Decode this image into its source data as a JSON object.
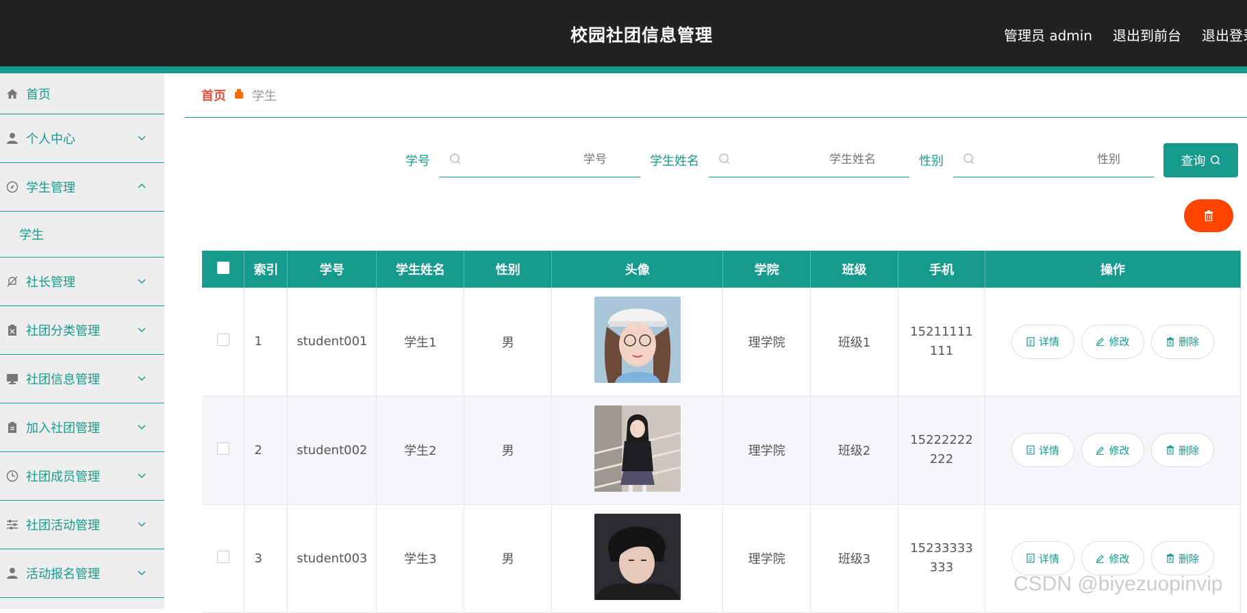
{
  "header": {
    "title": "校园社团信息管理",
    "admin_label": "管理员 admin",
    "to_front_label": "退出到前台",
    "logout_label": "退出登录"
  },
  "sidebar": {
    "items": [
      {
        "label": "首页",
        "icon": "home-icon"
      },
      {
        "label": "个人中心",
        "icon": "user-icon"
      },
      {
        "label": "学生管理",
        "icon": "compass-icon"
      },
      {
        "label": "学生",
        "icon": ""
      },
      {
        "label": "社长管理",
        "icon": "bell-off-icon"
      },
      {
        "label": "社团分类管理",
        "icon": "clipboard-icon"
      },
      {
        "label": "社团信息管理",
        "icon": "monitor-icon"
      },
      {
        "label": "加入社团管理",
        "icon": "clipboard-icon"
      },
      {
        "label": "社团成员管理",
        "icon": "clock-icon"
      },
      {
        "label": "社团活动管理",
        "icon": "sliders-icon"
      },
      {
        "label": "活动报名管理",
        "icon": "user-icon"
      }
    ]
  },
  "breadcrumb": {
    "home": "首页",
    "current": "学生"
  },
  "search": {
    "student_no_label": "学号",
    "student_no_placeholder": "学号",
    "name_label": "学生姓名",
    "name_placeholder": "学生姓名",
    "gender_label": "性别",
    "gender_placeholder": "性别",
    "query_label": "查询"
  },
  "table": {
    "columns": [
      "索引",
      "学号",
      "学生姓名",
      "性别",
      "头像",
      "学院",
      "班级",
      "手机",
      "操作"
    ],
    "rows": [
      {
        "index": "1",
        "student_no": "student001",
        "name": "学生1",
        "gender": "男",
        "college": "理学院",
        "class": "班级1",
        "phone": "15211111111"
      },
      {
        "index": "2",
        "student_no": "student002",
        "name": "学生2",
        "gender": "男",
        "college": "理学院",
        "class": "班级2",
        "phone": "15222222222"
      },
      {
        "index": "3",
        "student_no": "student003",
        "name": "学生3",
        "gender": "男",
        "college": "理学院",
        "class": "班级3",
        "phone": "15233333333"
      }
    ],
    "actions": {
      "detail": "详情",
      "edit": "修改",
      "delete": "删除"
    }
  },
  "watermark": "CSDN @biyezuopinvip",
  "colors": {
    "accent": "#179a8e",
    "danger": "#ff4500",
    "header_bg": "#222222"
  }
}
